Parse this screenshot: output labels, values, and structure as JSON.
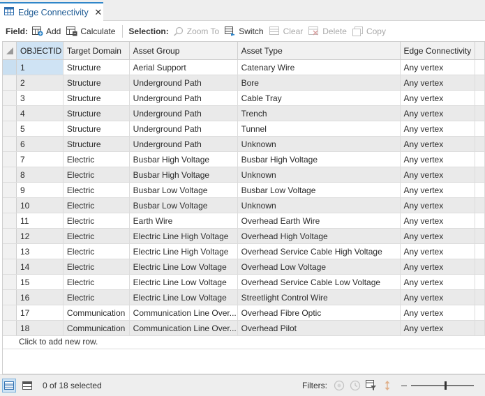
{
  "tab": {
    "title": "Edge Connectivity",
    "close_glyph": "✕"
  },
  "toolbar": {
    "field_label": "Field:",
    "add_label": "Add",
    "calculate_label": "Calculate",
    "selection_label": "Selection:",
    "zoom_label": "Zoom To",
    "switch_label": "Switch",
    "clear_label": "Clear",
    "delete_label": "Delete",
    "copy_label": "Copy"
  },
  "table": {
    "columns": [
      "OBJECTID",
      "Target Domain",
      "Asset Group",
      "Asset Type",
      "Edge Connectivity"
    ],
    "rows": [
      [
        "1",
        "Structure",
        "Aerial Support",
        "Catenary Wire",
        "Any vertex"
      ],
      [
        "2",
        "Structure",
        "Underground Path",
        "Bore",
        "Any vertex"
      ],
      [
        "3",
        "Structure",
        "Underground Path",
        "Cable Tray",
        "Any vertex"
      ],
      [
        "4",
        "Structure",
        "Underground Path",
        "Trench",
        "Any vertex"
      ],
      [
        "5",
        "Structure",
        "Underground Path",
        "Tunnel",
        "Any vertex"
      ],
      [
        "6",
        "Structure",
        "Underground Path",
        "Unknown",
        "Any vertex"
      ],
      [
        "7",
        "Electric",
        "Busbar High Voltage",
        "Busbar High Voltage",
        "Any vertex"
      ],
      [
        "8",
        "Electric",
        "Busbar High Voltage",
        "Unknown",
        "Any vertex"
      ],
      [
        "9",
        "Electric",
        "Busbar Low Voltage",
        "Busbar Low Voltage",
        "Any vertex"
      ],
      [
        "10",
        "Electric",
        "Busbar Low Voltage",
        "Unknown",
        "Any vertex"
      ],
      [
        "11",
        "Electric",
        "Earth Wire",
        "Overhead Earth Wire",
        "Any vertex"
      ],
      [
        "12",
        "Electric",
        "Electric Line High Voltage",
        "Overhead High Voltage",
        "Any vertex"
      ],
      [
        "13",
        "Electric",
        "Electric Line High Voltage",
        "Overhead Service Cable High Voltage",
        "Any vertex"
      ],
      [
        "14",
        "Electric",
        "Electric Line Low Voltage",
        "Overhead Low Voltage",
        "Any vertex"
      ],
      [
        "15",
        "Electric",
        "Electric Line Low Voltage",
        "Overhead Service Cable Low Voltage",
        "Any vertex"
      ],
      [
        "16",
        "Electric",
        "Electric Line Low Voltage",
        "Streetlight Control Wire",
        "Any vertex"
      ],
      [
        "17",
        "Communication",
        "Communication Line Over...",
        "Overhead Fibre Optic",
        "Any vertex"
      ],
      [
        "18",
        "Communication",
        "Communication Line Over...",
        "Overhead Pilot",
        "Any vertex"
      ]
    ],
    "add_row_text": "Click to add new row."
  },
  "status": {
    "selected_text": "0 of 18 selected",
    "filters_label": "Filters:",
    "zoom_level": 0.55
  },
  "colors": {
    "accent": "#2f86c9",
    "selection": "#cfe3f4"
  }
}
